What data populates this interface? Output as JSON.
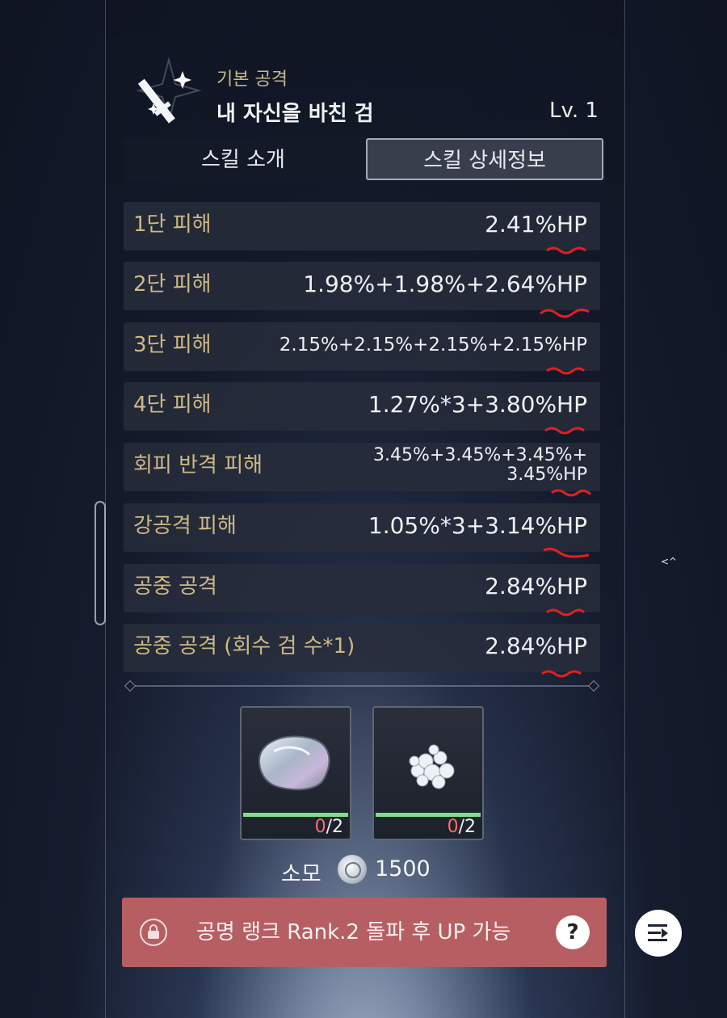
{
  "skill": {
    "category": "기본 공격",
    "name": "내 자신을 바친 검",
    "level": "Lv. 1"
  },
  "tabs": {
    "intro": "스킬 소개",
    "details": "스킬 상세정보",
    "active": "details"
  },
  "damage_rows": [
    {
      "label": "1단 피해",
      "value": "2.41%HP"
    },
    {
      "label": "2단 피해",
      "value": "1.98%+1.98%+2.64%HP"
    },
    {
      "label": "3단 피해",
      "value": "2.15%+2.15%+2.15%+2.15%HP"
    },
    {
      "label": "4단 피해",
      "value": "1.27%*3+3.80%HP"
    },
    {
      "label": "회피 반격 피해",
      "value_line1": "3.45%+3.45%+3.45%+",
      "value_line2": "3.45%HP"
    },
    {
      "label": "강공격 피해",
      "value": "1.05%*3+3.14%HP"
    },
    {
      "label": "공중 공격",
      "value": "2.84%HP"
    },
    {
      "label": "공중 공격 (회수 검 수*1)",
      "value": "2.84%HP"
    }
  ],
  "materials": [
    {
      "icon": "shell-icon",
      "owned": "0",
      "required": "/2",
      "progress": 1.0
    },
    {
      "icon": "coral-icon",
      "owned": "0",
      "required": "/2",
      "progress": 1.0
    }
  ],
  "cost": {
    "label": "소모",
    "amount": "1500",
    "icon": "coin-icon"
  },
  "upgrade": {
    "text": "공명 랭크 Rank.2 돌파 후 UP 가능",
    "help": "?"
  },
  "side": {
    "tiny_text": "<^"
  },
  "colors": {
    "label_gold": "#cdb985",
    "warning_red": "#b65e62",
    "progress_green": "#7fe08b",
    "annotation_red": "#e02020"
  }
}
